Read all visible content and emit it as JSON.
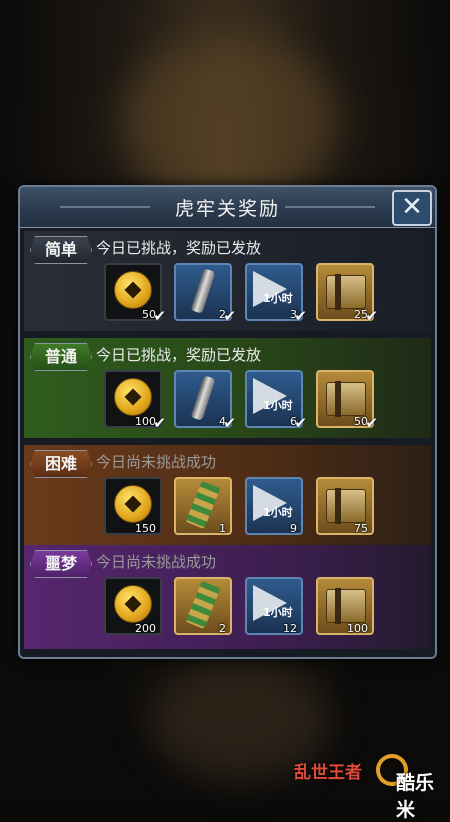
{
  "dialog": {
    "title": "虎牢关奖励",
    "close_symbol": "✕"
  },
  "sections": [
    {
      "badge": "简单",
      "status": "今日已挑战，奖励已发放",
      "items": [
        {
          "icon": "gold-coin-icon",
          "count": "50",
          "claimed": "✔"
        },
        {
          "icon": "scroll-icon",
          "count": "2",
          "claimed": "✔"
        },
        {
          "icon": "speedup-icon",
          "label": "1小时",
          "count": "3",
          "claimed": "✔"
        },
        {
          "icon": "treasure-chest-icon",
          "count": "25",
          "claimed": "✔"
        }
      ]
    },
    {
      "badge": "普通",
      "status": "今日已挑战，奖励已发放",
      "items": [
        {
          "icon": "gold-coin-icon",
          "count": "100",
          "claimed": "✔"
        },
        {
          "icon": "scroll-icon",
          "count": "4",
          "claimed": "✔"
        },
        {
          "icon": "speedup-icon",
          "label": "1小时",
          "count": "6",
          "claimed": "✔"
        },
        {
          "icon": "treasure-chest-icon",
          "count": "50",
          "claimed": "✔"
        }
      ]
    },
    {
      "badge": "困难",
      "status": "今日尚未挑战成功",
      "items": [
        {
          "icon": "gold-coin-icon",
          "count": "150"
        },
        {
          "icon": "gold-scroll-icon",
          "count": "1"
        },
        {
          "icon": "speedup-icon",
          "label": "1小时",
          "count": "9"
        },
        {
          "icon": "treasure-chest-icon",
          "count": "75"
        }
      ]
    },
    {
      "badge": "噩梦",
      "status": "今日尚未挑战成功",
      "items": [
        {
          "icon": "gold-coin-icon",
          "count": "200"
        },
        {
          "icon": "gold-scroll-icon",
          "count": "2"
        },
        {
          "icon": "speedup-icon",
          "label": "1小时",
          "count": "12"
        },
        {
          "icon": "treasure-chest-icon",
          "count": "100"
        }
      ]
    }
  ],
  "watermark": {
    "game_logo": "乱世王者",
    "site": "酷乐米"
  },
  "colors": {
    "easy": "#2a2d36",
    "normal": "#2f5d1e",
    "hard": "#6a3a1a",
    "nightmare": "#57266f",
    "frame": "#6b7d93"
  }
}
